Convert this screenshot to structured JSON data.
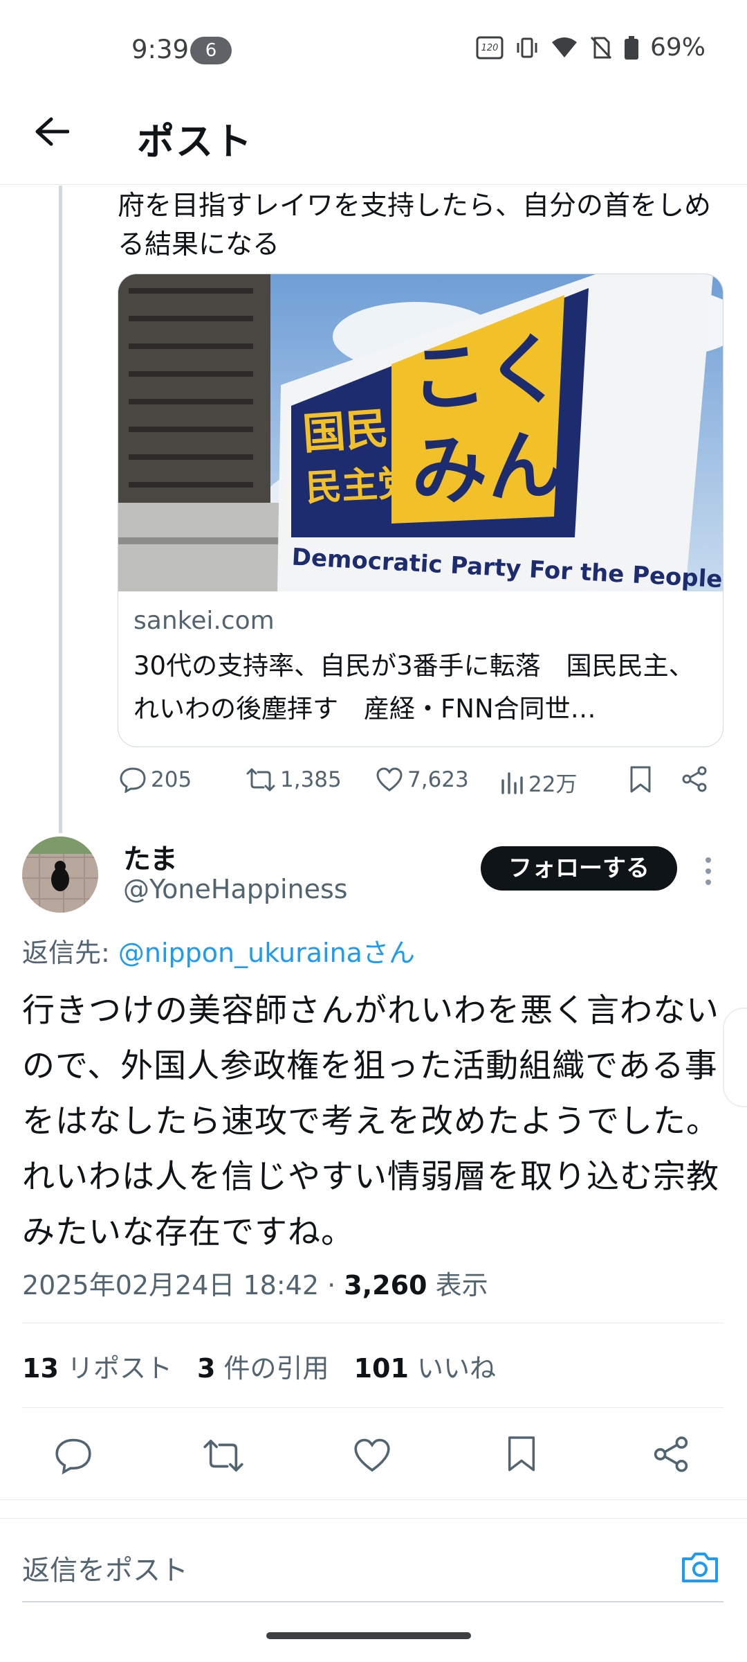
{
  "status_bar": {
    "time": "9:39",
    "notification_count": "6",
    "battery": "69%"
  },
  "header": {
    "title": "ポスト"
  },
  "quoted_post": {
    "text": "府を目指すレイワを支持したら、自分の首をしめる結果になる",
    "card": {
      "image_sign": {
        "kanji": "国民\n民主党",
        "kana": "こく\nみん",
        "english": "Democratic Party For the People"
      },
      "domain": "sankei.com",
      "title": "30代の支持率、自民が3番手に転落　国民民主、れいわの後塵拝す　産経・FNN合同世…"
    },
    "actions": {
      "replies": "205",
      "reposts": "1,385",
      "likes": "7,623",
      "views": "22万"
    }
  },
  "reply_post": {
    "display_name": "たま",
    "handle": "@YoneHappiness",
    "follow_label": "フォローする",
    "reply_to_label": "返信先:",
    "reply_to_handle": "@nippon_ukurainaさん",
    "text": "行きつけの美容師さんがれいわを悪く言わないので、外国人参政権を狙った活動組織である事をはなしたら速攻で考えを改めたようでした。れいわは人を信じやすい情弱層を取り込む宗教みたいな存在ですね。",
    "timestamp": "2025年02月24日 18:42 ·",
    "views_count": "3,260",
    "views_label": "表示",
    "stats": [
      {
        "count": "13",
        "label": "リポスト"
      },
      {
        "count": "3",
        "label": "件の引用"
      },
      {
        "count": "101",
        "label": "いいね"
      }
    ]
  },
  "composer": {
    "placeholder": "返信をポスト"
  },
  "colors": {
    "accent": "#1d9bf0",
    "muted": "#536471",
    "text": "#0f1419"
  }
}
